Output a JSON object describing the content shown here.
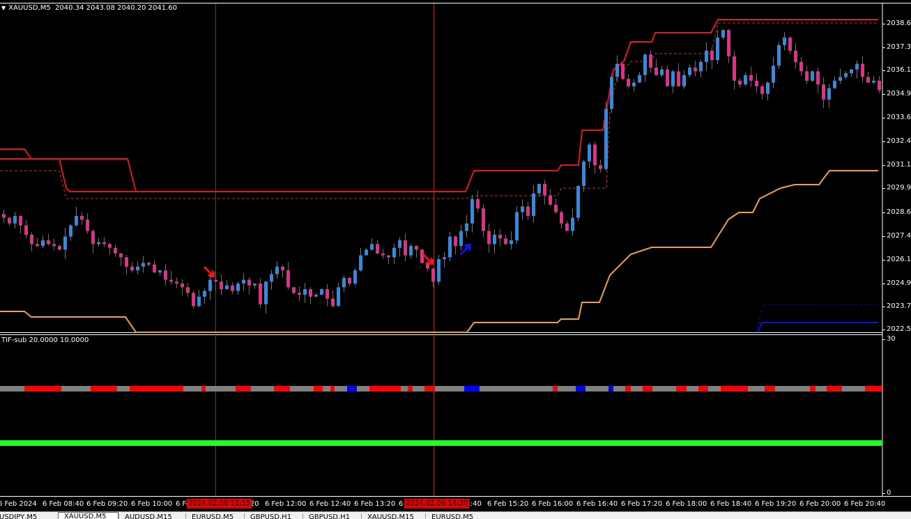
{
  "header": {
    "symbol": "XAUUSD,M5",
    "ohlc": "2040.34 2043.08 2040.20 2041.60"
  },
  "price_axis": [
    "2038.60",
    "2037.35",
    "2036.15",
    "2034.90",
    "2033.65",
    "2032.40",
    "2031.15",
    "2029.90",
    "2028.65",
    "2027.40",
    "2026.15",
    "2024.90",
    "2023.70",
    "2022.50"
  ],
  "subwindow": {
    "title": "TIF-sub 20.0000 10.0000",
    "scale_max": "30",
    "scale_min": "0"
  },
  "time_axis": [
    "6 Feb 2024",
    "6 Feb 08:40",
    "6 Feb 09:20",
    "6 Feb 10:00",
    "6 Fe",
    "1:20",
    "6 Feb 12:00",
    "6 Feb 12:40",
    "6 Feb 13:20",
    "6",
    "14:40",
    "6 Feb 15:20",
    "6 Feb 16:00",
    "6 Feb 16:40",
    "6 Feb 17:20",
    "6 Feb 18:00",
    "6 Feb 18:40",
    "6 Feb 19:20",
    "6 Feb 20:00",
    "6 Feb 20:40"
  ],
  "crosshair_labels": [
    "2024.02.06 11:15",
    "2024.02.06 14:30"
  ],
  "tabs": [
    {
      "label": "USDJPY,M5",
      "active": false
    },
    {
      "label": "XAUUSD,M5",
      "active": true
    },
    {
      "label": "AUDUSD,M15",
      "active": false
    },
    {
      "label": "EURUSD,M5",
      "active": false
    },
    {
      "label": "GBPUSD,H1",
      "active": false
    },
    {
      "label": "GBPUSD,H1",
      "active": false
    },
    {
      "label": "XAUUSD,M15",
      "active": false
    },
    {
      "label": "EURUSD,M5",
      "active": false
    }
  ],
  "colors": {
    "bull": "#2a8cf0",
    "bear": "#f0288c",
    "resistance": "#e01818",
    "support": "#f0a040",
    "signal_red": "#ff0000",
    "signal_blue": "#0000ff",
    "signal_gray": "#808080",
    "green_line": "#22ff22"
  },
  "chart_data": {
    "type": "candlestick",
    "title": "XAUUSD,M5",
    "ylim": [
      2022.2,
      2039.3
    ],
    "closes": [
      2028.3,
      2028.0,
      2028.4,
      2027.9,
      2027.4,
      2026.9,
      2026.8,
      2027.1,
      2026.9,
      2026.8,
      2026.6,
      2027.3,
      2027.9,
      2028.4,
      2028.2,
      2027.6,
      2026.9,
      2027.0,
      2026.9,
      2026.7,
      2026.4,
      2026.2,
      2025.7,
      2025.5,
      2025.7,
      2025.9,
      2025.8,
      2025.4,
      2025.5,
      2025.0,
      2024.9,
      2024.8,
      2024.6,
      2024.3,
      2023.6,
      2024.1,
      2024.4,
      2025.0,
      2024.9,
      2024.5,
      2024.7,
      2024.4,
      2024.8,
      2025.0,
      2024.7,
      2024.8,
      2023.7,
      2024.9,
      2025.3,
      2025.7,
      2025.5,
      2024.6,
      2024.3,
      2024.2,
      2024.5,
      2024.1,
      2024.2,
      2024.5,
      2024.0,
      2023.6,
      2024.6,
      2025.1,
      2024.8,
      2025.5,
      2026.3,
      2026.6,
      2026.9,
      2026.4,
      2026.3,
      2026.2,
      2026.7,
      2027.1,
      2026.3,
      2026.8,
      2026.6,
      2025.9,
      2025.6,
      2024.9,
      2026.1,
      2026.2,
      2027.3,
      2026.8,
      2027.6,
      2028.0,
      2029.3,
      2028.8,
      2027.6,
      2026.9,
      2027.4,
      2027.2,
      2026.9,
      2027.1,
      2028.6,
      2028.9,
      2028.4,
      2029.6,
      2030.1,
      2029.5,
      2029.0,
      2028.6,
      2028.0,
      2027.6,
      2028.3,
      2030.0,
      2031.3,
      2032.2,
      2031.1,
      2030.9,
      2034.1,
      2035.8,
      2036.5,
      2035.7,
      2035.3,
      2035.5,
      2035.9,
      2037.0,
      2036.3,
      2035.9,
      2036.2,
      2035.3,
      2036.1,
      2035.3,
      2035.9,
      2036.3,
      2036.1,
      2036.6,
      2037.2,
      2036.7,
      2037.9,
      2038.3,
      2036.9,
      2035.6,
      2035.4,
      2035.9,
      2035.6,
      2035.3,
      2034.9,
      2035.5,
      2036.4,
      2037.5,
      2037.9,
      2037.2,
      2036.6,
      2036.1,
      2035.6,
      2036.1,
      2035.4,
      2034.6,
      2035.2,
      2035.6,
      2035.8,
      2036.0,
      2036.2,
      2036.5,
      2035.8,
      2035.5,
      2035.6,
      2035.1
    ]
  }
}
